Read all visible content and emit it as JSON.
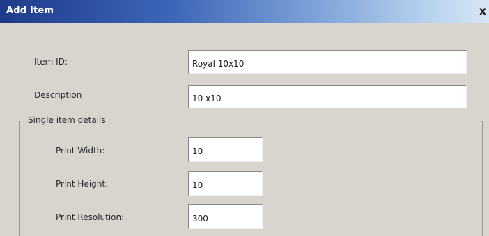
{
  "dialog": {
    "title": "Add Item",
    "close_glyph": "x"
  },
  "form": {
    "item_id": {
      "label": "Item ID:",
      "value": "Royal 10x10"
    },
    "description": {
      "label": "Description",
      "value": "10 x10"
    }
  },
  "single_item_details": {
    "legend": "Single item details",
    "print_width": {
      "label": "Print Width:",
      "value": "10"
    },
    "print_height": {
      "label": "Print Height:",
      "value": "10"
    },
    "print_resolution": {
      "label": "Print Resolution:",
      "value": "300"
    }
  }
}
